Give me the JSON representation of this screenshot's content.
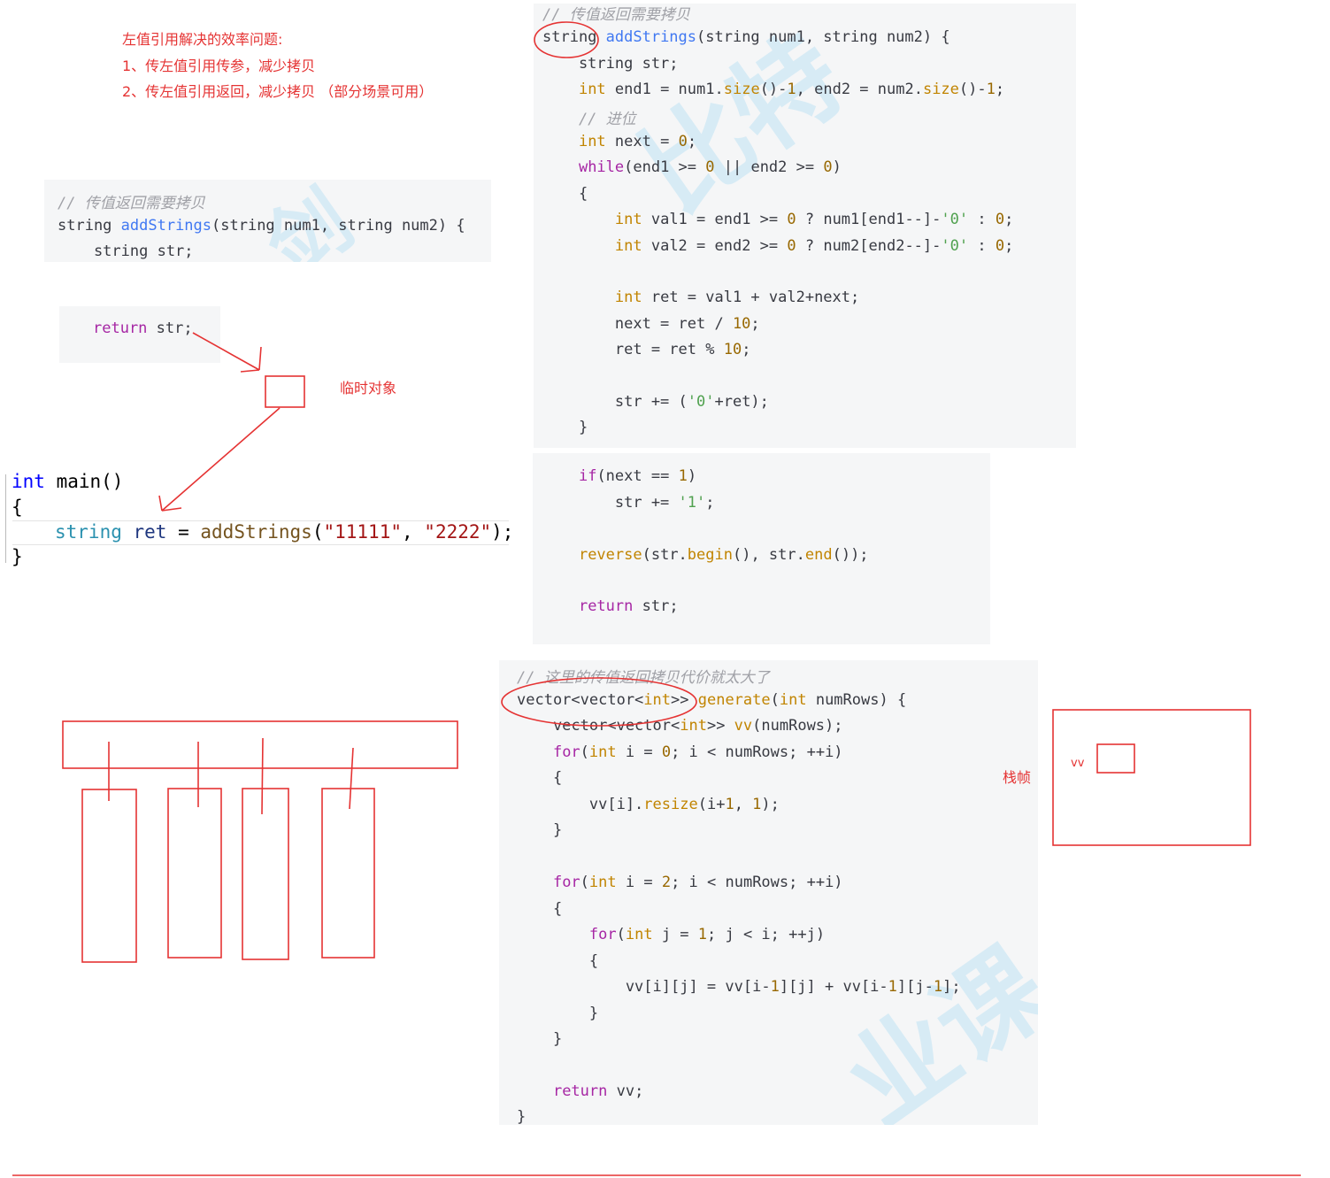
{
  "notes": {
    "heading": "左值引用解决的效率问题:",
    "item1": "1、传左值引用传参，减少拷贝",
    "item2": "2、传左值引用返回，减少拷贝  （部分场景可用）",
    "temp_object": "临时对象",
    "stack_frame": "栈帧",
    "vv_label": "vv"
  },
  "snippet_small": {
    "comment": "// 传值返回需要拷贝",
    "sig_type": "string ",
    "sig_fn": "addStrings",
    "sig_rest": "(string num1, string num2) {",
    "line2": "    string str;"
  },
  "snippet_return": {
    "kw": "return",
    "rest": " str;"
  },
  "main_code": {
    "line1_kw": "int",
    "line1_rest": " main()",
    "line2": "{",
    "line3_type": "string",
    "line3_var": "ret",
    "line3_eq": " = ",
    "line3_fn": "addStrings",
    "line3_arg1": "\"11111\"",
    "line3_sep": ", ",
    "line3_arg2": "\"2222\"",
    "line3_end": ");",
    "line4": "}"
  },
  "snippet_top": {
    "comment": "// 传值返回需要拷贝",
    "l1a": "string ",
    "l1fn": "addStrings",
    "l1b": "(string num1, string num2) {",
    "l2": "    string str;",
    "l3a": "    ",
    "l3ty": "int",
    "l3b": " end1 = num1.",
    "l3fn1": "size",
    "l3c": "()-",
    "l3n1": "1",
    "l3d": ", end2 = num2.",
    "l3fn2": "size",
    "l3e": "()-",
    "l3n2": "1",
    "l3f": ";",
    "l4": "    // 进位",
    "l5a": "    ",
    "l5ty": "int",
    "l5b": " next = ",
    "l5n": "0",
    "l5c": ";",
    "l6a": "    ",
    "l6kw": "while",
    "l6b": "(end1 >= ",
    "l6n1": "0",
    "l6c": " || end2 >= ",
    "l6n2": "0",
    "l6d": ")",
    "l7": "    {",
    "l8a": "        ",
    "l8ty": "int",
    "l8b": " val1 = end1 >= ",
    "l8n1": "0",
    "l8c": " ? num1[end1--]-",
    "l8s": "'0'",
    "l8d": " : ",
    "l8n2": "0",
    "l8e": ";",
    "l9a": "        ",
    "l9ty": "int",
    "l9b": " val2 = end2 >= ",
    "l9n1": "0",
    "l9c": " ? num2[end2--]-",
    "l9s": "'0'",
    "l9d": " : ",
    "l9n2": "0",
    "l9e": ";",
    "l10a": "        ",
    "l10ty": "int",
    "l10b": " ret = val1 + val2+next;",
    "l11a": "        next = ret / ",
    "l11n": "10",
    "l11b": ";",
    "l12a": "        ret = ret % ",
    "l12n": "10",
    "l12b": ";",
    "l13a": "        str += (",
    "l13s": "'0'",
    "l13b": "+ret);",
    "l14": "    }"
  },
  "snippet_mid": {
    "l1a": "    ",
    "l1kw": "if",
    "l1b": "(next == ",
    "l1n": "1",
    "l1c": ")",
    "l2a": "        str += ",
    "l2s": "'1'",
    "l2b": ";",
    "l3a": "    ",
    "l3fn": "reverse",
    "l3b": "(str.",
    "l3fn2": "begin",
    "l3c": "(), str.",
    "l3fn3": "end",
    "l3d": "());",
    "l4a": "    ",
    "l4kw": "return",
    "l4b": " str;"
  },
  "snippet_bottom": {
    "comment": "// 这里的传值返回拷贝代价就太大了",
    "l1a": "vector<vector<",
    "l1ty": "int",
    "l1b": ">> ",
    "l1fn": "generate",
    "l1c": "(",
    "l1ty2": "int",
    "l1d": " numRows) {",
    "l2a": "    vector<vector<",
    "l2ty": "int",
    "l2b": ">> ",
    "l2fn": "vv",
    "l2c": "(numRows);",
    "l3a": "    ",
    "l3kw": "for",
    "l3b": "(",
    "l3ty": "int",
    "l3c": " i = ",
    "l3n": "0",
    "l3d": "; i < numRows; ++i)",
    "l4": "    {",
    "l5a": "        vv[i].",
    "l5fn": "resize",
    "l5b": "(i+",
    "l5n1": "1",
    "l5c": ", ",
    "l5n2": "1",
    "l5d": ");",
    "l6": "    }",
    "l7a": "    ",
    "l7kw": "for",
    "l7b": "(",
    "l7ty": "int",
    "l7c": " i = ",
    "l7n": "2",
    "l7d": "; i < numRows; ++i)",
    "l8": "    {",
    "l9a": "        ",
    "l9kw": "for",
    "l9b": "(",
    "l9ty": "int",
    "l9c": " j = ",
    "l9n": "1",
    "l9d": "; j < i; ++j)",
    "l10": "        {",
    "l11a": "            vv[i][j] = vv[i-",
    "l11n1": "1",
    "l11b": "][j] + vv[i-",
    "l11n2": "1",
    "l11c": "][j-",
    "l11n3": "1",
    "l11d": "];",
    "l12": "        }",
    "l13": "    }",
    "l14a": "    ",
    "l14kw": "return",
    "l14b": " vv;",
    "l15": "}"
  },
  "colors": {
    "annotation_red": "#e53333",
    "code_bg": "#f5f6f7"
  }
}
